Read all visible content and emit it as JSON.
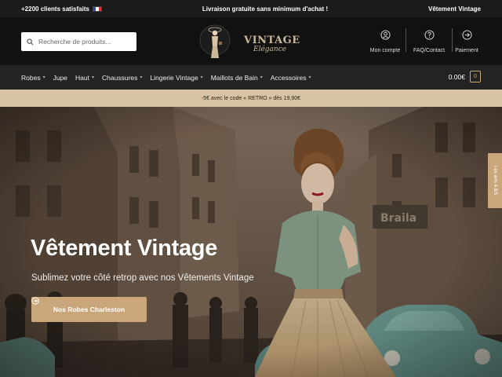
{
  "topbar": {
    "left_text": "+2200 clients satisfaits",
    "center_text": "Livraison gratuite sans minimum d'achat !",
    "right_text": "Vêtement Vintage"
  },
  "search": {
    "placeholder": "Recherche de produits..."
  },
  "logo": {
    "title": "VINTAGE",
    "script": "Elégance"
  },
  "header_links": [
    {
      "label": "Mon compte",
      "icon": "user-icon"
    },
    {
      "label": "FAQ/Contact",
      "icon": "question-icon"
    },
    {
      "label": "Paiement",
      "icon": "arrow-right-circle-icon"
    }
  ],
  "nav": [
    {
      "label": "Robes",
      "dropdown": true
    },
    {
      "label": "Jupe",
      "dropdown": false
    },
    {
      "label": "Haut",
      "dropdown": true
    },
    {
      "label": "Chaussures",
      "dropdown": true
    },
    {
      "label": "Lingerie Vintage",
      "dropdown": true
    },
    {
      "label": "Maillots de Bain",
      "dropdown": true
    },
    {
      "label": "Accessoires",
      "dropdown": true
    }
  ],
  "cart": {
    "total": "0.00€",
    "count": "0"
  },
  "promo": {
    "text": "-5€ avec le code « RETRO » dès 19,90€"
  },
  "hero": {
    "title": "Vêtement Vintage",
    "subtitle": "Sublimez votre côté retrop avec nos Vêtements Vintage",
    "button_label": "Nos Robes Charleston",
    "reviews_tab": "Les avis 4.8/5"
  },
  "colors": {
    "accent": "#caa77a",
    "promo_bg": "#d8c4a4",
    "nav_bg": "#232323",
    "header_bg": "#111111"
  }
}
